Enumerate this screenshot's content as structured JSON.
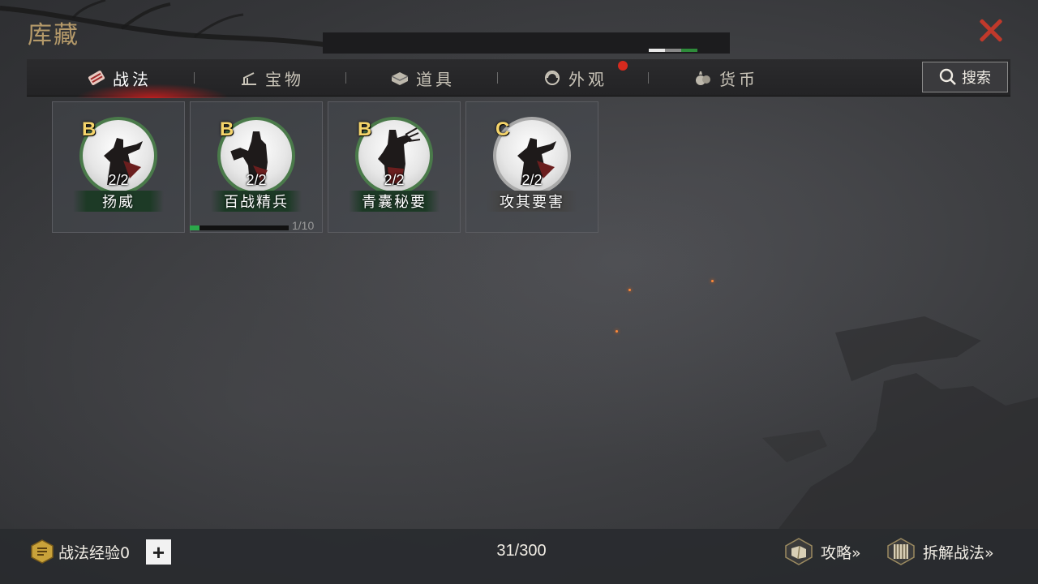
{
  "header": {
    "title": "库藏",
    "close_icon": "close-icon"
  },
  "tabs": [
    {
      "label": "战法",
      "icon": "tactics-icon",
      "active": true
    },
    {
      "label": "宝物",
      "icon": "treasure-icon",
      "active": false
    },
    {
      "label": "道具",
      "icon": "item-chest-icon",
      "active": false
    },
    {
      "label": "外观",
      "icon": "appearance-icon",
      "active": false,
      "has_notification": true
    },
    {
      "label": "货币",
      "icon": "money-bag-icon",
      "active": false
    }
  ],
  "search": {
    "label": "搜索"
  },
  "cards": [
    {
      "grade": "B",
      "count": "2/2",
      "name": "扬威"
    },
    {
      "grade": "B",
      "count": "2/2",
      "name": "百战精兵",
      "progress_text": "1/10",
      "progress": 0.1
    },
    {
      "grade": "B",
      "count": "2/2",
      "name": "青囊秘要"
    },
    {
      "grade": "C",
      "count": "2/2",
      "name": "攻其要害"
    }
  ],
  "footer": {
    "exp_label": "战法经验0",
    "plus": "+",
    "capacity": "31/300",
    "guide_label": "攻略»",
    "dismantle_label": "拆解战法»"
  },
  "colors": {
    "accent_red": "#c0392b",
    "grade_gold": "#f5d46a",
    "grade_b_ring": "#4a7a4a",
    "grade_c_ring": "#a8a8a8",
    "progress_green": "#2ba84a"
  }
}
